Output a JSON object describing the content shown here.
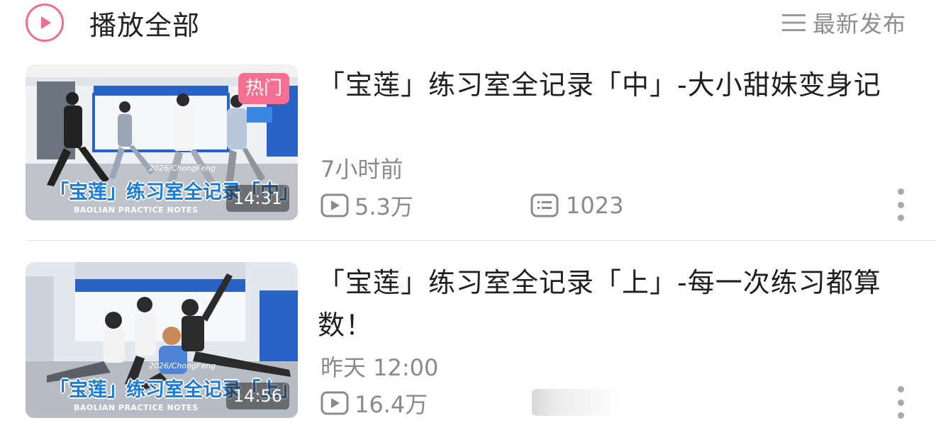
{
  "header": {
    "play_all_label": "播放全部",
    "sort_label": "最新发布",
    "icons": {
      "play": "play-circle-icon",
      "sort": "sort-lines-icon"
    }
  },
  "videos": [
    {
      "title": "「宝莲」练习室全记录「中」-大小甜妹变身记",
      "badge": "热门",
      "duration": "14:31",
      "time": "7小时前",
      "views": "5.3万",
      "comments": "1023",
      "thumb_banner": "「宝莲」练习室全记录「中」",
      "thumb_banner_sub": "BAOLIAN PRACTICE NOTES",
      "thumb_year": "2026/ChongFeng"
    },
    {
      "title": "「宝莲」练习室全记录「上」-每一次练习都算数！",
      "duration": "14:56",
      "time": "昨天 12:00",
      "views": "16.4万",
      "thumb_banner": "「宝莲」练习室全记录「上」",
      "thumb_banner_sub": "BAOLIAN PRACTICE NOTES",
      "thumb_year": "2026/ChongFeng"
    }
  ],
  "colors": {
    "accent_pink": "#f06d8e",
    "badge_pink": "#f46f90",
    "meta_gray": "#8a8a8a",
    "banner_blue": "#1c7bd6"
  }
}
